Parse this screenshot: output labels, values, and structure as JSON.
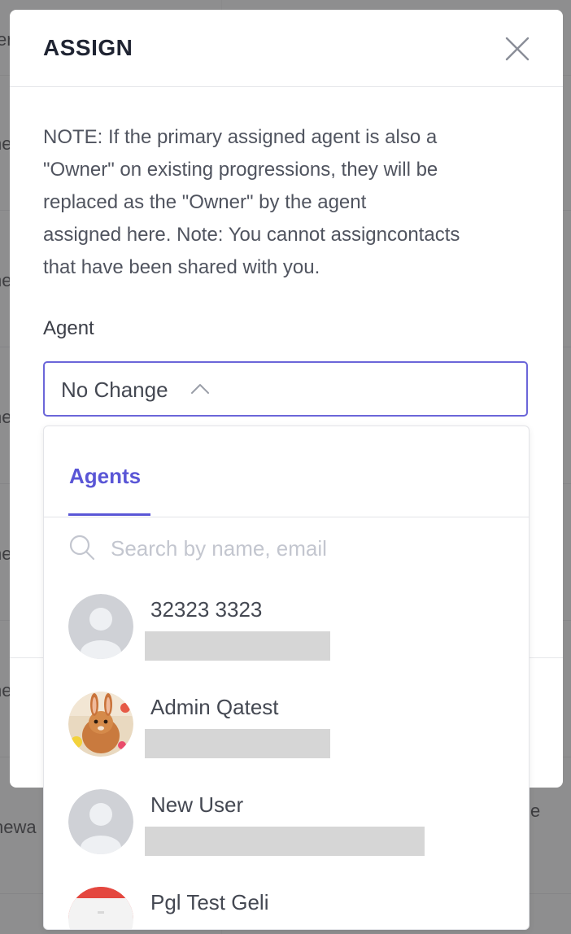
{
  "background": {
    "fragments": [
      "er",
      "ne",
      "ne",
      "ne",
      "ne",
      "ne",
      "newa",
      "e"
    ]
  },
  "modal": {
    "title": "ASSIGN",
    "close_icon": "close-icon",
    "note_lines": [
      "NOTE: If the primary assigned agent is also a",
      "\"Owner\" on existing progressions, they will be",
      "replaced as the \"Owner\" by the agent",
      "assigned here. Note: You cannot assigncontacts",
      "that have been shared with you."
    ],
    "agent_label": "Agent",
    "agent_select": {
      "value": "No Change",
      "icon": "chevron-up-icon",
      "accent": "#6b66d9"
    }
  },
  "dropdown": {
    "tab_label": "Agents",
    "accent": "#5a56d6",
    "search_placeholder": "Search by name, email",
    "search_icon": "search-icon",
    "agents": [
      {
        "name": "32323 3323",
        "avatar": "default-avatar-icon"
      },
      {
        "name": "Admin Qatest",
        "avatar": "bunny-photo-avatar"
      },
      {
        "name": "New User",
        "avatar": "default-avatar-icon"
      },
      {
        "name": "Pgl Test Geli",
        "avatar": "red-white-avatar"
      }
    ]
  }
}
